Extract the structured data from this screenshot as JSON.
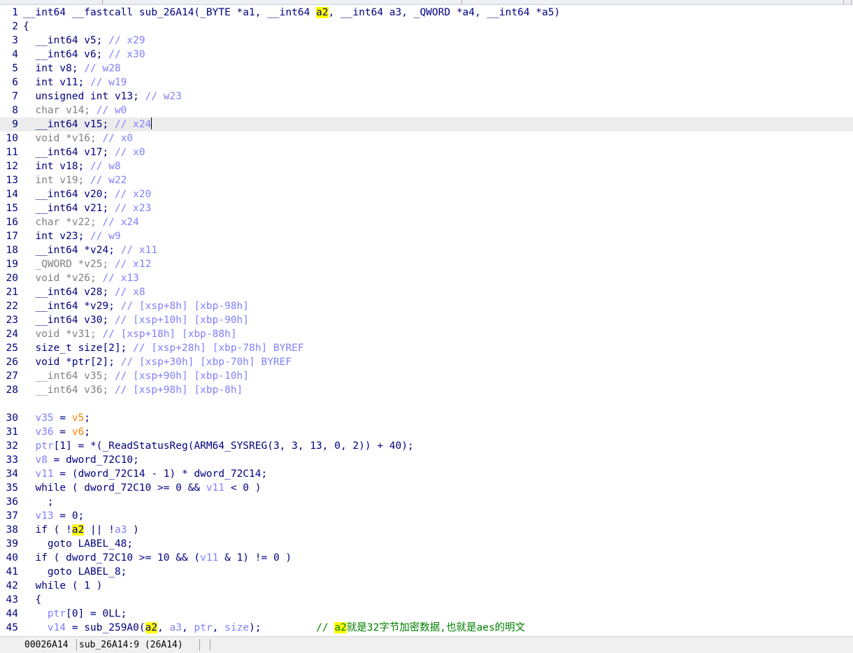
{
  "code_lines": [
    {
      "n": "1",
      "t": [
        [
          "k",
          "__int64 __fastcall sub_26A14(_BYTE *a1, __int64 "
        ],
        [
          "h",
          "a2"
        ],
        [
          "k",
          ", __int64 a3, _QWORD *a4, __int64 *a5)"
        ]
      ]
    },
    {
      "n": "2",
      "t": [
        [
          "k",
          "{"
        ]
      ]
    },
    {
      "n": "3",
      "t": [
        [
          "k",
          "  __int64 v5; "
        ],
        [
          "c",
          "// x29"
        ]
      ]
    },
    {
      "n": "4",
      "t": [
        [
          "k",
          "  __int64 v6; "
        ],
        [
          "c",
          "// x30"
        ]
      ]
    },
    {
      "n": "5",
      "t": [
        [
          "k",
          "  int v8; "
        ],
        [
          "c",
          "// w28"
        ]
      ]
    },
    {
      "n": "6",
      "t": [
        [
          "k",
          "  int v11; "
        ],
        [
          "c",
          "// w19"
        ]
      ]
    },
    {
      "n": "7",
      "t": [
        [
          "k",
          "  unsigned int v13; "
        ],
        [
          "c",
          "// w23"
        ]
      ]
    },
    {
      "n": "8",
      "t": [
        [
          "g",
          "  char v14; "
        ],
        [
          "c",
          "// w0"
        ]
      ]
    },
    {
      "n": "9",
      "cur": true,
      "t": [
        [
          "k",
          "  __int64 v15; "
        ],
        [
          "c",
          "// x24"
        ]
      ]
    },
    {
      "n": "10",
      "t": [
        [
          "g",
          "  void *v16; "
        ],
        [
          "c",
          "// x0"
        ]
      ]
    },
    {
      "n": "11",
      "t": [
        [
          "k",
          "  __int64 v17; "
        ],
        [
          "c",
          "// x0"
        ]
      ]
    },
    {
      "n": "12",
      "t": [
        [
          "k",
          "  int v18; "
        ],
        [
          "c",
          "// w8"
        ]
      ]
    },
    {
      "n": "13",
      "t": [
        [
          "g",
          "  int v19; "
        ],
        [
          "c",
          "// w22"
        ]
      ]
    },
    {
      "n": "14",
      "t": [
        [
          "k",
          "  __int64 v20; "
        ],
        [
          "c",
          "// x20"
        ]
      ]
    },
    {
      "n": "15",
      "t": [
        [
          "k",
          "  __int64 v21; "
        ],
        [
          "c",
          "// x23"
        ]
      ]
    },
    {
      "n": "16",
      "t": [
        [
          "g",
          "  char *v22; "
        ],
        [
          "c",
          "// x24"
        ]
      ]
    },
    {
      "n": "17",
      "t": [
        [
          "k",
          "  int v23; "
        ],
        [
          "c",
          "// w9"
        ]
      ]
    },
    {
      "n": "18",
      "t": [
        [
          "k",
          "  __int64 *v24; "
        ],
        [
          "c",
          "// x11"
        ]
      ]
    },
    {
      "n": "19",
      "t": [
        [
          "g",
          "  _QWORD *v25; "
        ],
        [
          "c",
          "// x12"
        ]
      ]
    },
    {
      "n": "20",
      "t": [
        [
          "g",
          "  void *v26; "
        ],
        [
          "c",
          "// x13"
        ]
      ]
    },
    {
      "n": "21",
      "t": [
        [
          "k",
          "  __int64 v28; "
        ],
        [
          "c",
          "// x8"
        ]
      ]
    },
    {
      "n": "22",
      "t": [
        [
          "k",
          "  __int64 *v29; "
        ],
        [
          "c",
          "// [xsp+8h] [xbp-98h]"
        ]
      ]
    },
    {
      "n": "23",
      "t": [
        [
          "k",
          "  __int64 v30; "
        ],
        [
          "c",
          "// [xsp+10h] [xbp-90h]"
        ]
      ]
    },
    {
      "n": "24",
      "t": [
        [
          "g",
          "  void *v31; "
        ],
        [
          "c",
          "// [xsp+18h] [xbp-88h]"
        ]
      ]
    },
    {
      "n": "25",
      "t": [
        [
          "k",
          "  size_t size[2]; "
        ],
        [
          "c",
          "// [xsp+28h] [xbp-78h] BYREF"
        ]
      ]
    },
    {
      "n": "26",
      "t": [
        [
          "k",
          "  void *ptr[2]; "
        ],
        [
          "c",
          "// [xsp+30h] [xbp-70h] BYREF"
        ]
      ]
    },
    {
      "n": "27",
      "t": [
        [
          "g",
          "  __int64 v35; "
        ],
        [
          "c",
          "// [xsp+90h] [xbp-10h]"
        ]
      ]
    },
    {
      "n": "28",
      "t": [
        [
          "g",
          "  __int64 v36; "
        ],
        [
          "c",
          "// [xsp+98h] [xbp-8h]"
        ]
      ]
    },
    {
      "n": "",
      "t": []
    },
    {
      "n": "30",
      "t": [
        [
          "p",
          "  "
        ],
        [
          "v",
          "v35"
        ],
        [
          "p",
          " = "
        ],
        [
          "o",
          "v5"
        ],
        [
          "p",
          ";"
        ]
      ]
    },
    {
      "n": "31",
      "t": [
        [
          "p",
          "  "
        ],
        [
          "v",
          "v36"
        ],
        [
          "p",
          " = "
        ],
        [
          "o",
          "v6"
        ],
        [
          "p",
          ";"
        ]
      ]
    },
    {
      "n": "32",
      "t": [
        [
          "p",
          "  "
        ],
        [
          "v",
          "ptr"
        ],
        [
          "p",
          "[1] = *(_ReadStatusReg(ARM64_SYSREG(3, 3, 13, 0, 2)) + 40);"
        ]
      ]
    },
    {
      "n": "33",
      "t": [
        [
          "p",
          "  "
        ],
        [
          "v",
          "v8"
        ],
        [
          "p",
          " = dword_72C10;"
        ]
      ]
    },
    {
      "n": "34",
      "t": [
        [
          "p",
          "  "
        ],
        [
          "v",
          "v11"
        ],
        [
          "p",
          " = (dword_72C14 - 1) * dword_72C14;"
        ]
      ]
    },
    {
      "n": "35",
      "t": [
        [
          "p",
          "  while ( dword_72C10 >= 0 && "
        ],
        [
          "v",
          "v11"
        ],
        [
          "p",
          " < 0 )"
        ]
      ]
    },
    {
      "n": "36",
      "t": [
        [
          "p",
          "    ;"
        ]
      ]
    },
    {
      "n": "37",
      "t": [
        [
          "p",
          "  "
        ],
        [
          "v",
          "v13"
        ],
        [
          "p",
          " = 0;"
        ]
      ]
    },
    {
      "n": "38",
      "t": [
        [
          "p",
          "  if ( !"
        ],
        [
          "h",
          "a2"
        ],
        [
          "p",
          " || !"
        ],
        [
          "v",
          "a3"
        ],
        [
          "p",
          " )"
        ]
      ]
    },
    {
      "n": "39",
      "t": [
        [
          "p",
          "    goto LABEL_48;"
        ]
      ]
    },
    {
      "n": "40",
      "t": [
        [
          "p",
          "  if ( dword_72C10 >= 10 && ("
        ],
        [
          "v",
          "v11"
        ],
        [
          "p",
          " & 1) != 0 )"
        ]
      ]
    },
    {
      "n": "41",
      "t": [
        [
          "p",
          "    goto LABEL_8;"
        ]
      ]
    },
    {
      "n": "42",
      "t": [
        [
          "p",
          "  while ( 1 )"
        ]
      ]
    },
    {
      "n": "43",
      "t": [
        [
          "p",
          "  {"
        ]
      ]
    },
    {
      "n": "44",
      "t": [
        [
          "p",
          "    "
        ],
        [
          "v",
          "ptr"
        ],
        [
          "p",
          "[0] = 0LL;"
        ]
      ]
    },
    {
      "n": "45",
      "t": [
        [
          "p",
          "    "
        ],
        [
          "v",
          "v14"
        ],
        [
          "p",
          " = sub_259A0("
        ],
        [
          "h",
          "a2"
        ],
        [
          "p",
          ", "
        ],
        [
          "v",
          "a3"
        ],
        [
          "p",
          ", "
        ],
        [
          "v",
          "ptr"
        ],
        [
          "p",
          ", "
        ],
        [
          "v",
          "size"
        ],
        [
          "p",
          ");         "
        ],
        [
          "cg",
          "// "
        ],
        [
          "ch",
          "a2"
        ],
        [
          "cg",
          "就是32字节加密数据,也就是aes的明文"
        ]
      ]
    }
  ],
  "statusbar": {
    "address": "00026A14",
    "location": "sub_26A14:9 (26A14)"
  },
  "colors": {
    "keyword": "#000080",
    "comment": "#8080ff",
    "greyed_decl": "#808080",
    "argument_var": "#ff8000",
    "highlight_bg": "#ffff00",
    "user_comment": "#008000",
    "current_line_bg": "#ececec"
  }
}
